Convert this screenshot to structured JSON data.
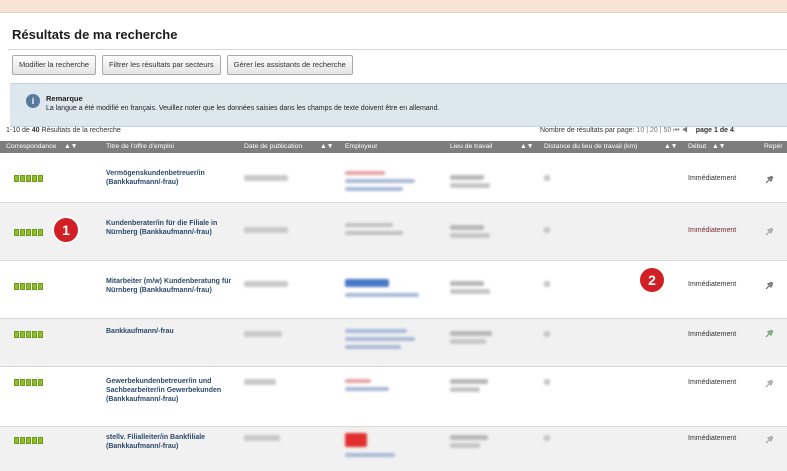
{
  "page": {
    "title": "Résultats de ma recherche"
  },
  "toolbar": {
    "modify_label": "Modifier la recherche",
    "filter_label": "Filtrer les résultats par secteurs",
    "manage_label": "Gérer les assistants de recherche"
  },
  "notice": {
    "heading": "Remarque",
    "text": "La langue a été modifié en français. Veuillez noter que les données saisies dans les champs de texte doivent être en allemand."
  },
  "results": {
    "range": "1-10 de",
    "count": "40",
    "label": "Résultats de la recherche",
    "per_page_label": "Nombre de résultats par page:",
    "per_page_options": "10 | 20 | 50",
    "page_label": "page 1 de 4"
  },
  "columns": {
    "match": "Correspondance",
    "title": "Titre de l'offre d'emploi",
    "date": "Date de publication",
    "employer": "Employeur",
    "location": "Lieu de travail",
    "distance": "Distance du lieu de travail (km)",
    "start": "Début",
    "bookmark": "Repér"
  },
  "rows": [
    {
      "title": "Vermögenskundenbetreuer/in (Bankkaufmann/-frau)",
      "start": "Immédiatement",
      "stars": 5
    },
    {
      "title": "Kundenberater/in für die Filiale in Nürnberg (Bankkaufmann/-frau)",
      "start": "Immédiatement",
      "stars": 5
    },
    {
      "title": "Mitarbeiter (m/w) Kundenberatung für Nürnberg (Bankkaufmann/-frau)",
      "start": "Immédiatement",
      "stars": 5
    },
    {
      "title": "Bankkaufmann/-frau",
      "start": "Immédiatement",
      "stars": 5
    },
    {
      "title": "Gewerbekundenbetreuer/in und Sachbearbeiter/in Gewerbekunden (Bankkaufmann/-frau)",
      "start": "Immédiatement",
      "stars": 5
    },
    {
      "title": "stellv. Filialleiter/in Bankfiliale (Bankkaufmann/-frau)",
      "start": "Immédiatement",
      "stars": 5
    }
  ],
  "callouts": {
    "one": "1",
    "two": "2"
  },
  "colors": {
    "background": "#f6e3d3",
    "header_bar": "#7d7d7d",
    "notice_bg": "#dde7ee",
    "stars": "#8fbf2b",
    "title_link": "#2a4a6e",
    "badge": "#d11f25"
  }
}
